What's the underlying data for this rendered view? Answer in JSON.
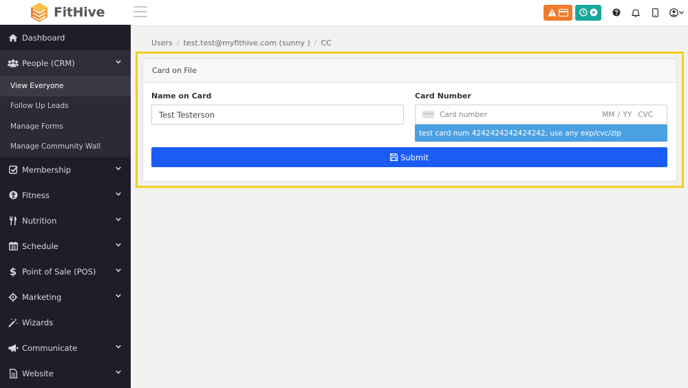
{
  "app": {
    "name": "FitHive"
  },
  "colors": {
    "accent": "#1b5cf5",
    "alert": "#f07a2b",
    "timer": "#17a79b",
    "info": "#4aa1e1",
    "highlight": "#f4cd1e",
    "sidebar": "#1e1d28"
  },
  "sidebar": {
    "items": [
      {
        "label": "Dashboard",
        "icon": "home-icon"
      },
      {
        "label": "People (CRM)",
        "icon": "users-icon",
        "open": true,
        "children": [
          "View Everyone",
          "Follow Up Leads",
          "Manage Forms",
          "Manage Community Wall"
        ],
        "active_child": "View Everyone"
      },
      {
        "label": "Membership",
        "icon": "check-square-icon"
      },
      {
        "label": "Fitness",
        "icon": "fitness-icon"
      },
      {
        "label": "Nutrition",
        "icon": "utensils-icon"
      },
      {
        "label": "Schedule",
        "icon": "calendar-icon"
      },
      {
        "label": "Point of Sale (POS)",
        "icon": "dollar-icon"
      },
      {
        "label": "Marketing",
        "icon": "crosshair-icon"
      },
      {
        "label": "Wizards",
        "icon": "magic-wand-icon"
      },
      {
        "label": "Communicate",
        "icon": "megaphone-icon"
      },
      {
        "label": "Website",
        "icon": "file-icon"
      }
    ]
  },
  "breadcrumb": {
    "items": [
      "Users",
      "test.test@myfithive.com (sunny )",
      "CC"
    ]
  },
  "card": {
    "title": "Card on File",
    "name_label": "Name on Card",
    "name_value": "Test Testerson",
    "number_label": "Card Number",
    "number_placeholder": "Card number",
    "exp_cvc_placeholder": "MM / YY  CVC",
    "info_text": "test card num 4242424242424242, use any exp/cvc/zip",
    "submit_label": "Submit"
  }
}
